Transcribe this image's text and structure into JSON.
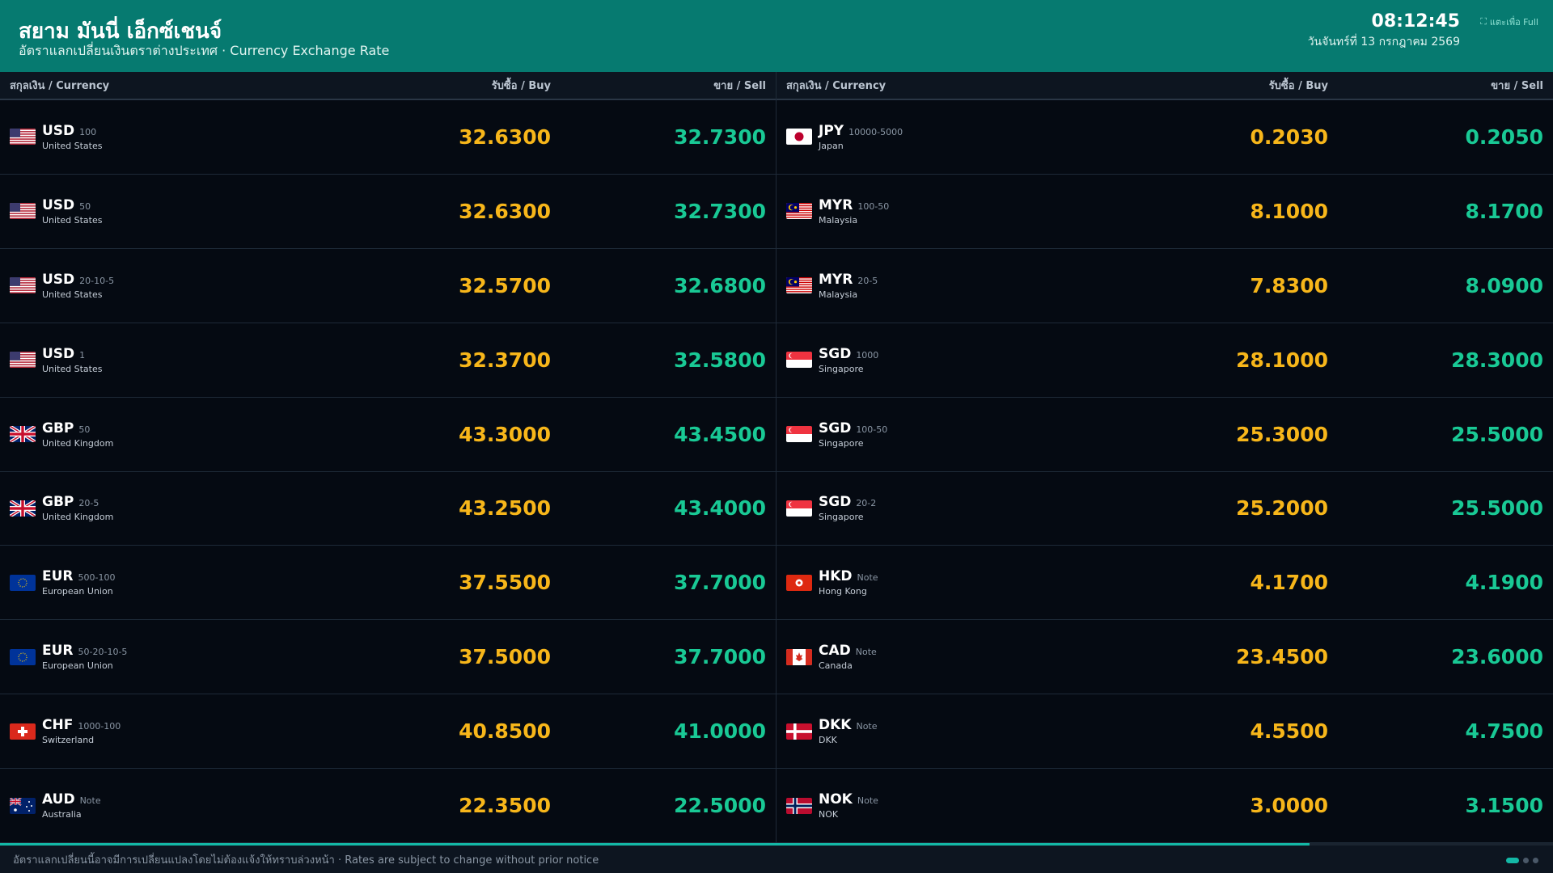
{
  "header": {
    "title": "สยาม มันนี่ เอ็กซ์เชนจ์",
    "subtitle": "อัตราแลกเปลี่ยนเงินตราต่างประเทศ · Currency Exchange Rate",
    "time": "08:12:45",
    "date": "วันจันทร์ที่ 13 กรกฎาคม 2569",
    "fullscreen_label": "แตะเพื่อ Full"
  },
  "columns": {
    "currency": "สกุลเงิน / Currency",
    "buy": "รับซื้อ / Buy",
    "sell": "ขาย / Sell"
  },
  "left_rates": [
    {
      "code": "USD",
      "denom": "100",
      "country": "United States",
      "buy": "32.6300",
      "sell": "32.7300",
      "flag": "us-flag-icon"
    },
    {
      "code": "USD",
      "denom": "50",
      "country": "United States",
      "buy": "32.6300",
      "sell": "32.7300",
      "flag": "us-flag-icon"
    },
    {
      "code": "USD",
      "denom": "20-10-5",
      "country": "United States",
      "buy": "32.5700",
      "sell": "32.6800",
      "flag": "us-flag-icon"
    },
    {
      "code": "USD",
      "denom": "1",
      "country": "United States",
      "buy": "32.3700",
      "sell": "32.5800",
      "flag": "us-flag-icon"
    },
    {
      "code": "GBP",
      "denom": "50",
      "country": "United Kingdom",
      "buy": "43.3000",
      "sell": "43.4500",
      "flag": "uk-flag-icon"
    },
    {
      "code": "GBP",
      "denom": "20-5",
      "country": "United Kingdom",
      "buy": "43.2500",
      "sell": "43.4000",
      "flag": "uk-flag-icon"
    },
    {
      "code": "EUR",
      "denom": "500-100",
      "country": "European Union",
      "buy": "37.5500",
      "sell": "37.7000",
      "flag": "eu-flag-icon"
    },
    {
      "code": "EUR",
      "denom": "50-20-10-5",
      "country": "European Union",
      "buy": "37.5000",
      "sell": "37.7000",
      "flag": "eu-flag-icon"
    },
    {
      "code": "CHF",
      "denom": "1000-100",
      "country": "Switzerland",
      "buy": "40.8500",
      "sell": "41.0000",
      "flag": "ch-flag-icon"
    },
    {
      "code": "AUD",
      "denom": "Note",
      "country": "Australia",
      "buy": "22.3500",
      "sell": "22.5000",
      "flag": "au-flag-icon"
    }
  ],
  "right_rates": [
    {
      "code": "JPY",
      "denom": "10000-5000",
      "country": "Japan",
      "buy": "0.2030",
      "sell": "0.2050",
      "flag": "jp-flag-icon"
    },
    {
      "code": "MYR",
      "denom": "100-50",
      "country": "Malaysia",
      "buy": "8.1000",
      "sell": "8.1700",
      "flag": "my-flag-icon"
    },
    {
      "code": "MYR",
      "denom": "20-5",
      "country": "Malaysia",
      "buy": "7.8300",
      "sell": "8.0900",
      "flag": "my-flag-icon"
    },
    {
      "code": "SGD",
      "denom": "1000",
      "country": "Singapore",
      "buy": "28.1000",
      "sell": "28.3000",
      "flag": "sg-flag-icon"
    },
    {
      "code": "SGD",
      "denom": "100-50",
      "country": "Singapore",
      "buy": "25.3000",
      "sell": "25.5000",
      "flag": "sg-flag-icon"
    },
    {
      "code": "SGD",
      "denom": "20-2",
      "country": "Singapore",
      "buy": "25.2000",
      "sell": "25.5000",
      "flag": "sg-flag-icon"
    },
    {
      "code": "HKD",
      "denom": "Note",
      "country": "Hong Kong",
      "buy": "4.1700",
      "sell": "4.1900",
      "flag": "hk-flag-icon"
    },
    {
      "code": "CAD",
      "denom": "Note",
      "country": "Canada",
      "buy": "23.4500",
      "sell": "23.6000",
      "flag": "ca-flag-icon"
    },
    {
      "code": "DKK",
      "denom": "Note",
      "country": "DKK",
      "buy": "4.5500",
      "sell": "4.7500",
      "flag": "dk-flag-icon"
    },
    {
      "code": "NOK",
      "denom": "Note",
      "country": "NOK",
      "buy": "3.0000",
      "sell": "3.1500",
      "flag": "no-flag-icon"
    }
  ],
  "footer": {
    "notice": "อัตราแลกเปลี่ยนนี้อาจมีการเปลี่ยนแปลงโดยไม่ต้องแจ้งให้ทราบล่วงหน้า · Rates are subject to change without prior notice",
    "progress_fraction": 0.843,
    "page_count": 3,
    "active_page": 1
  },
  "colors": {
    "header_bg": "#067a70",
    "buy": "#f7b61a",
    "sell": "#19c995",
    "background": "#050a12"
  }
}
